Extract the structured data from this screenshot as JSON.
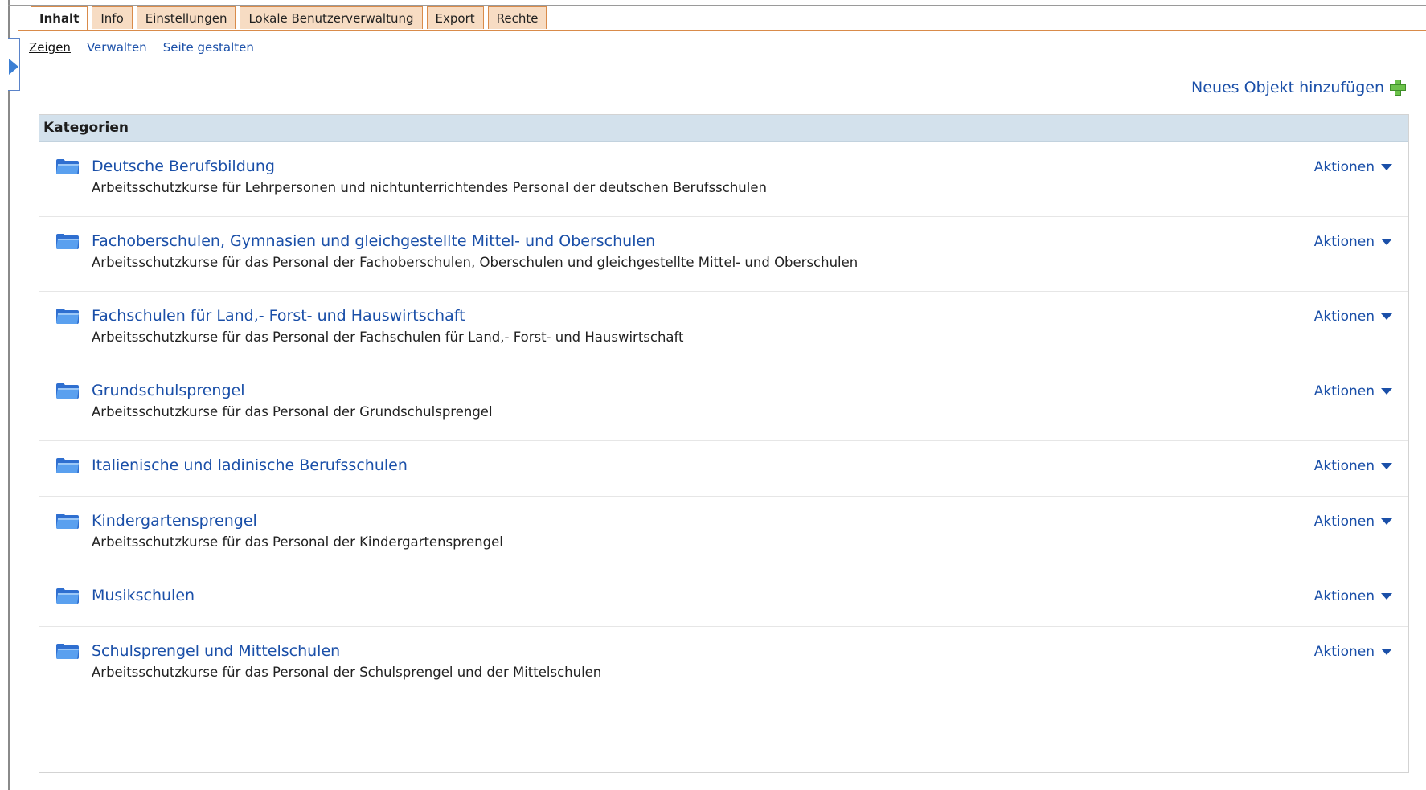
{
  "tabs": [
    {
      "label": "Inhalt",
      "active": true
    },
    {
      "label": "Info",
      "active": false
    },
    {
      "label": "Einstellungen",
      "active": false
    },
    {
      "label": "Lokale Benutzerverwaltung",
      "active": false
    },
    {
      "label": "Export",
      "active": false
    },
    {
      "label": "Rechte",
      "active": false
    }
  ],
  "subtabs": [
    {
      "label": "Zeigen",
      "active": true
    },
    {
      "label": "Verwalten",
      "active": false
    },
    {
      "label": "Seite gestalten",
      "active": false
    }
  ],
  "add_object": {
    "label": "Neues Objekt hinzufügen",
    "icon": "plus-icon",
    "icon_color": "#6cc24a"
  },
  "panel": {
    "header": "Kategorien",
    "actions_label": "Aktionen",
    "categories": [
      {
        "title": "Deutsche Berufsbildung",
        "description": "Arbeitsschutzkurse für Lehrpersonen und nichtunterrichtendes Personal der deutschen Berufsschulen"
      },
      {
        "title": "Fachoberschulen, Gymnasien und gleichgestellte Mittel- und Oberschulen",
        "description": "Arbeitsschutzkurse für das Personal der Fachoberschulen, Oberschulen und gleichgestellte Mittel- und Oberschulen"
      },
      {
        "title": "Fachschulen für Land,- Forst- und Hauswirtschaft",
        "description": "Arbeitsschutzkurse für das Personal der Fachschulen für Land,- Forst- und Hauswirtschaft"
      },
      {
        "title": "Grundschulsprengel",
        "description": "Arbeitsschutzkurse für das Personal der Grundschulsprengel"
      },
      {
        "title": "Italienische und ladinische Berufsschulen",
        "description": ""
      },
      {
        "title": "Kindergartensprengel",
        "description": "Arbeitsschutzkurse für das Personal der Kindergartensprengel"
      },
      {
        "title": "Musikschulen",
        "description": ""
      },
      {
        "title": "Schulsprengel und Mittelschulen",
        "description": "Arbeitsschutzkurse für das Personal der Schulsprengel und der Mittelschulen"
      }
    ]
  },
  "colors": {
    "link": "#1a4fa8",
    "tab_bg": "#f7dcc3",
    "tab_border": "#d98b4a",
    "header_bg": "#d3e1ec"
  }
}
